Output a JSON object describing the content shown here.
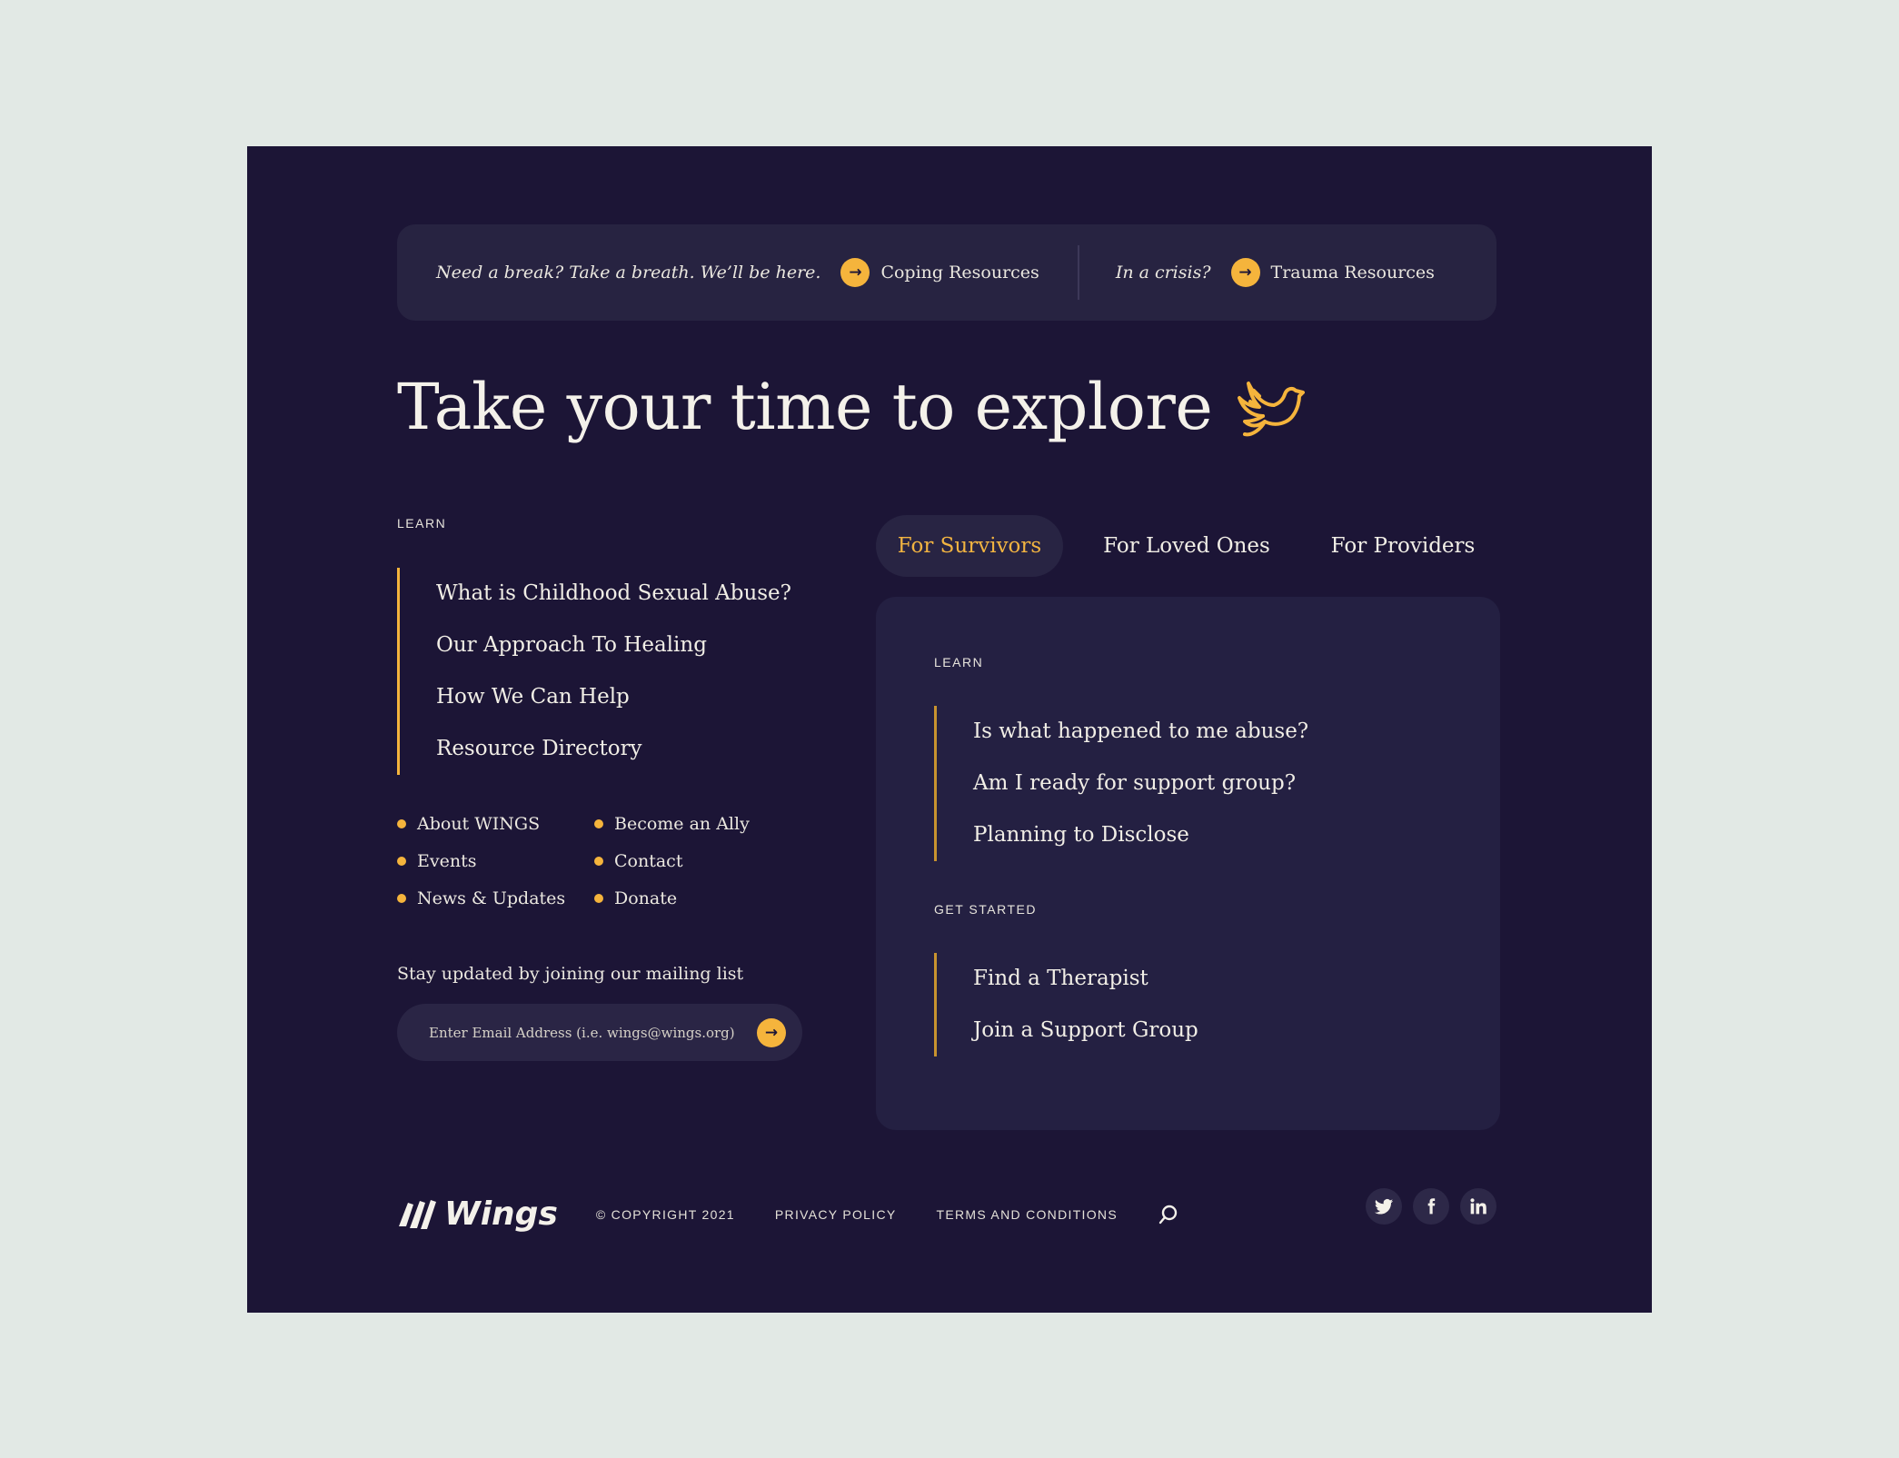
{
  "banner": {
    "tagline": "Need a break? Take a breath. We’ll be here.",
    "coping_label": "Coping Resources",
    "crisis_text": "In a crisis?",
    "trauma_label": "Trauma Resources"
  },
  "hero": {
    "title": "Take your time to explore",
    "icon": "dove-icon"
  },
  "left": {
    "eyebrow": "LEARN",
    "links": [
      "What is Childhood Sexual Abuse?",
      "Our Approach To Healing",
      "How We Can Help",
      "Resource Directory"
    ],
    "bullets_col1": [
      "About WINGS",
      "Events",
      "News & Updates"
    ],
    "bullets_col2": [
      "Become an Ally",
      "Contact",
      "Donate"
    ],
    "mailing_label": "Stay updated by joining our mailing list",
    "email_placeholder": "Enter Email Address (i.e. wings@wings.org)"
  },
  "tabs": [
    {
      "label": "For Survivors",
      "active": true
    },
    {
      "label": "For Loved Ones",
      "active": false
    },
    {
      "label": "For Providers",
      "active": false
    }
  ],
  "card": {
    "learn_eyebrow": "LEARN",
    "learn_links": [
      "Is what happened to me abuse?",
      "Am I ready for support group?",
      "Planning to Disclose"
    ],
    "start_eyebrow": "GET STARTED",
    "start_links": [
      "Find a Therapist",
      "Join a Support Group"
    ]
  },
  "footer": {
    "brand": "Wings",
    "copyright": "© COPYRIGHT 2021",
    "privacy": "PRIVACY POLICY",
    "terms": "TERMS AND CONDITIONS"
  },
  "socials": [
    "twitter-icon",
    "facebook-icon",
    "linkedin-icon"
  ],
  "colors": {
    "background": "#e2e9e5",
    "panel": "#1c1536",
    "accent": "#f5b43c",
    "card": "#242042"
  }
}
